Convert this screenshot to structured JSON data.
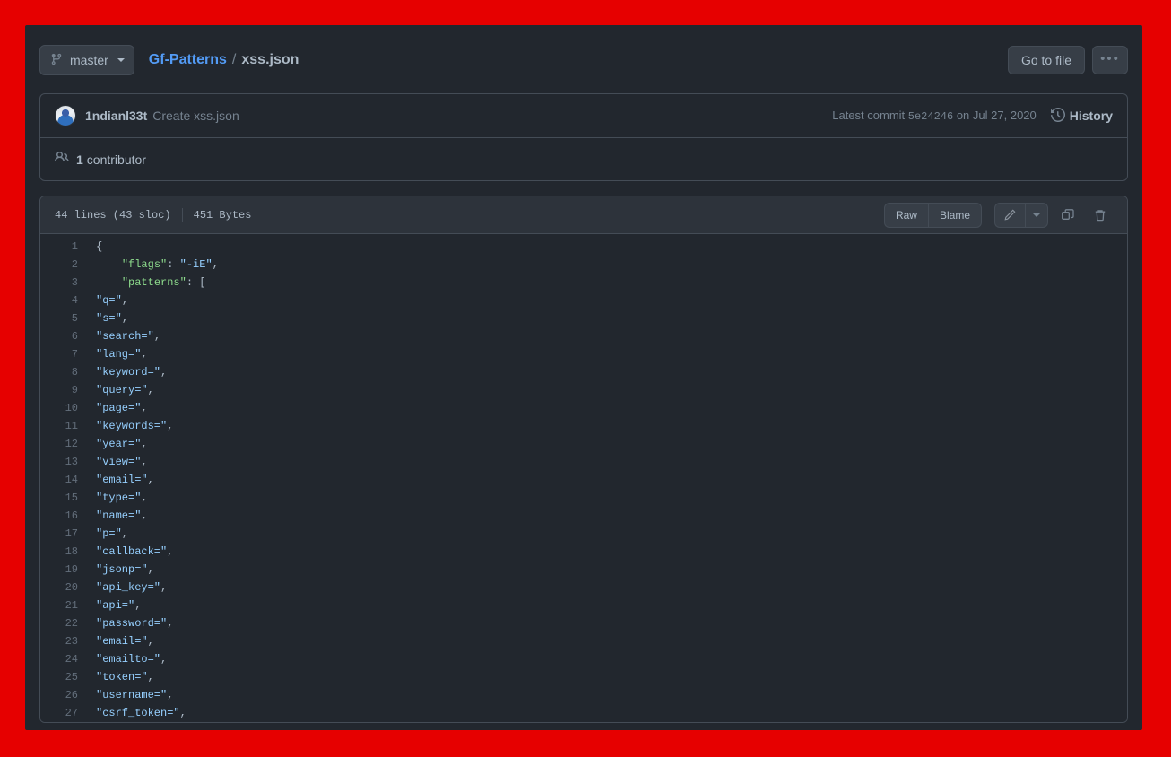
{
  "frame": {
    "border_color": "#e60000"
  },
  "topbar": {
    "branch": "master",
    "branch_icon": "git-branch-icon",
    "repo": "Gf-Patterns",
    "separator": "/",
    "file": "xss.json",
    "go_to_file": "Go to file",
    "kebab": "•••"
  },
  "commit": {
    "author": "1ndianl33t",
    "message": "Create xss.json",
    "latest_prefix": "Latest commit",
    "sha": "5e24246",
    "date_prefix": "on",
    "date": "Jul 27, 2020",
    "history": "History",
    "contributor_count": "1",
    "contributor_label": "contributor"
  },
  "file": {
    "lines_info": "44 lines (43 sloc)",
    "size": "451 Bytes",
    "raw": "Raw",
    "blame": "Blame",
    "edit_icon": "pencil-icon",
    "edit_dropdown_icon": "chevron-down-icon",
    "copy_icon": "copy-icon",
    "delete_icon": "trash-icon"
  },
  "code": {
    "language": "json",
    "lines": [
      {
        "n": "1",
        "indent": 0,
        "type": "punct",
        "text": "{"
      },
      {
        "n": "2",
        "indent": 4,
        "type": "kv",
        "key": "\"flags\"",
        "value": "\"-iE\"",
        "tail": ","
      },
      {
        "n": "3",
        "indent": 4,
        "type": "karr",
        "key": "\"patterns\"",
        "value": "["
      },
      {
        "n": "4",
        "indent": 0,
        "type": "str",
        "text": "\"q=\"",
        "tail": ","
      },
      {
        "n": "5",
        "indent": 0,
        "type": "str",
        "text": "\"s=\"",
        "tail": ","
      },
      {
        "n": "6",
        "indent": 0,
        "type": "str",
        "text": "\"search=\"",
        "tail": ","
      },
      {
        "n": "7",
        "indent": 0,
        "type": "str",
        "text": "\"lang=\"",
        "tail": ","
      },
      {
        "n": "8",
        "indent": 0,
        "type": "str",
        "text": "\"keyword=\"",
        "tail": ","
      },
      {
        "n": "9",
        "indent": 0,
        "type": "str",
        "text": "\"query=\"",
        "tail": ","
      },
      {
        "n": "10",
        "indent": 0,
        "type": "str",
        "text": "\"page=\"",
        "tail": ","
      },
      {
        "n": "11",
        "indent": 0,
        "type": "str",
        "text": "\"keywords=\"",
        "tail": ","
      },
      {
        "n": "12",
        "indent": 0,
        "type": "str",
        "text": "\"year=\"",
        "tail": ","
      },
      {
        "n": "13",
        "indent": 0,
        "type": "str",
        "text": "\"view=\"",
        "tail": ","
      },
      {
        "n": "14",
        "indent": 0,
        "type": "str",
        "text": "\"email=\"",
        "tail": ","
      },
      {
        "n": "15",
        "indent": 0,
        "type": "str",
        "text": "\"type=\"",
        "tail": ","
      },
      {
        "n": "16",
        "indent": 0,
        "type": "str",
        "text": "\"name=\"",
        "tail": ","
      },
      {
        "n": "17",
        "indent": 0,
        "type": "str",
        "text": "\"p=\"",
        "tail": ","
      },
      {
        "n": "18",
        "indent": 0,
        "type": "str",
        "text": "\"callback=\"",
        "tail": ","
      },
      {
        "n": "19",
        "indent": 0,
        "type": "str",
        "text": "\"jsonp=\"",
        "tail": ","
      },
      {
        "n": "20",
        "indent": 0,
        "type": "str",
        "text": "\"api_key=\"",
        "tail": ","
      },
      {
        "n": "21",
        "indent": 0,
        "type": "str",
        "text": "\"api=\"",
        "tail": ","
      },
      {
        "n": "22",
        "indent": 0,
        "type": "str",
        "text": "\"password=\"",
        "tail": ","
      },
      {
        "n": "23",
        "indent": 0,
        "type": "str",
        "text": "\"email=\"",
        "tail": ","
      },
      {
        "n": "24",
        "indent": 0,
        "type": "str",
        "text": "\"emailto=\"",
        "tail": ","
      },
      {
        "n": "25",
        "indent": 0,
        "type": "str",
        "text": "\"token=\"",
        "tail": ","
      },
      {
        "n": "26",
        "indent": 0,
        "type": "str",
        "text": "\"username=\"",
        "tail": ","
      },
      {
        "n": "27",
        "indent": 0,
        "type": "str",
        "text": "\"csrf_token=\"",
        "tail": ","
      }
    ]
  }
}
